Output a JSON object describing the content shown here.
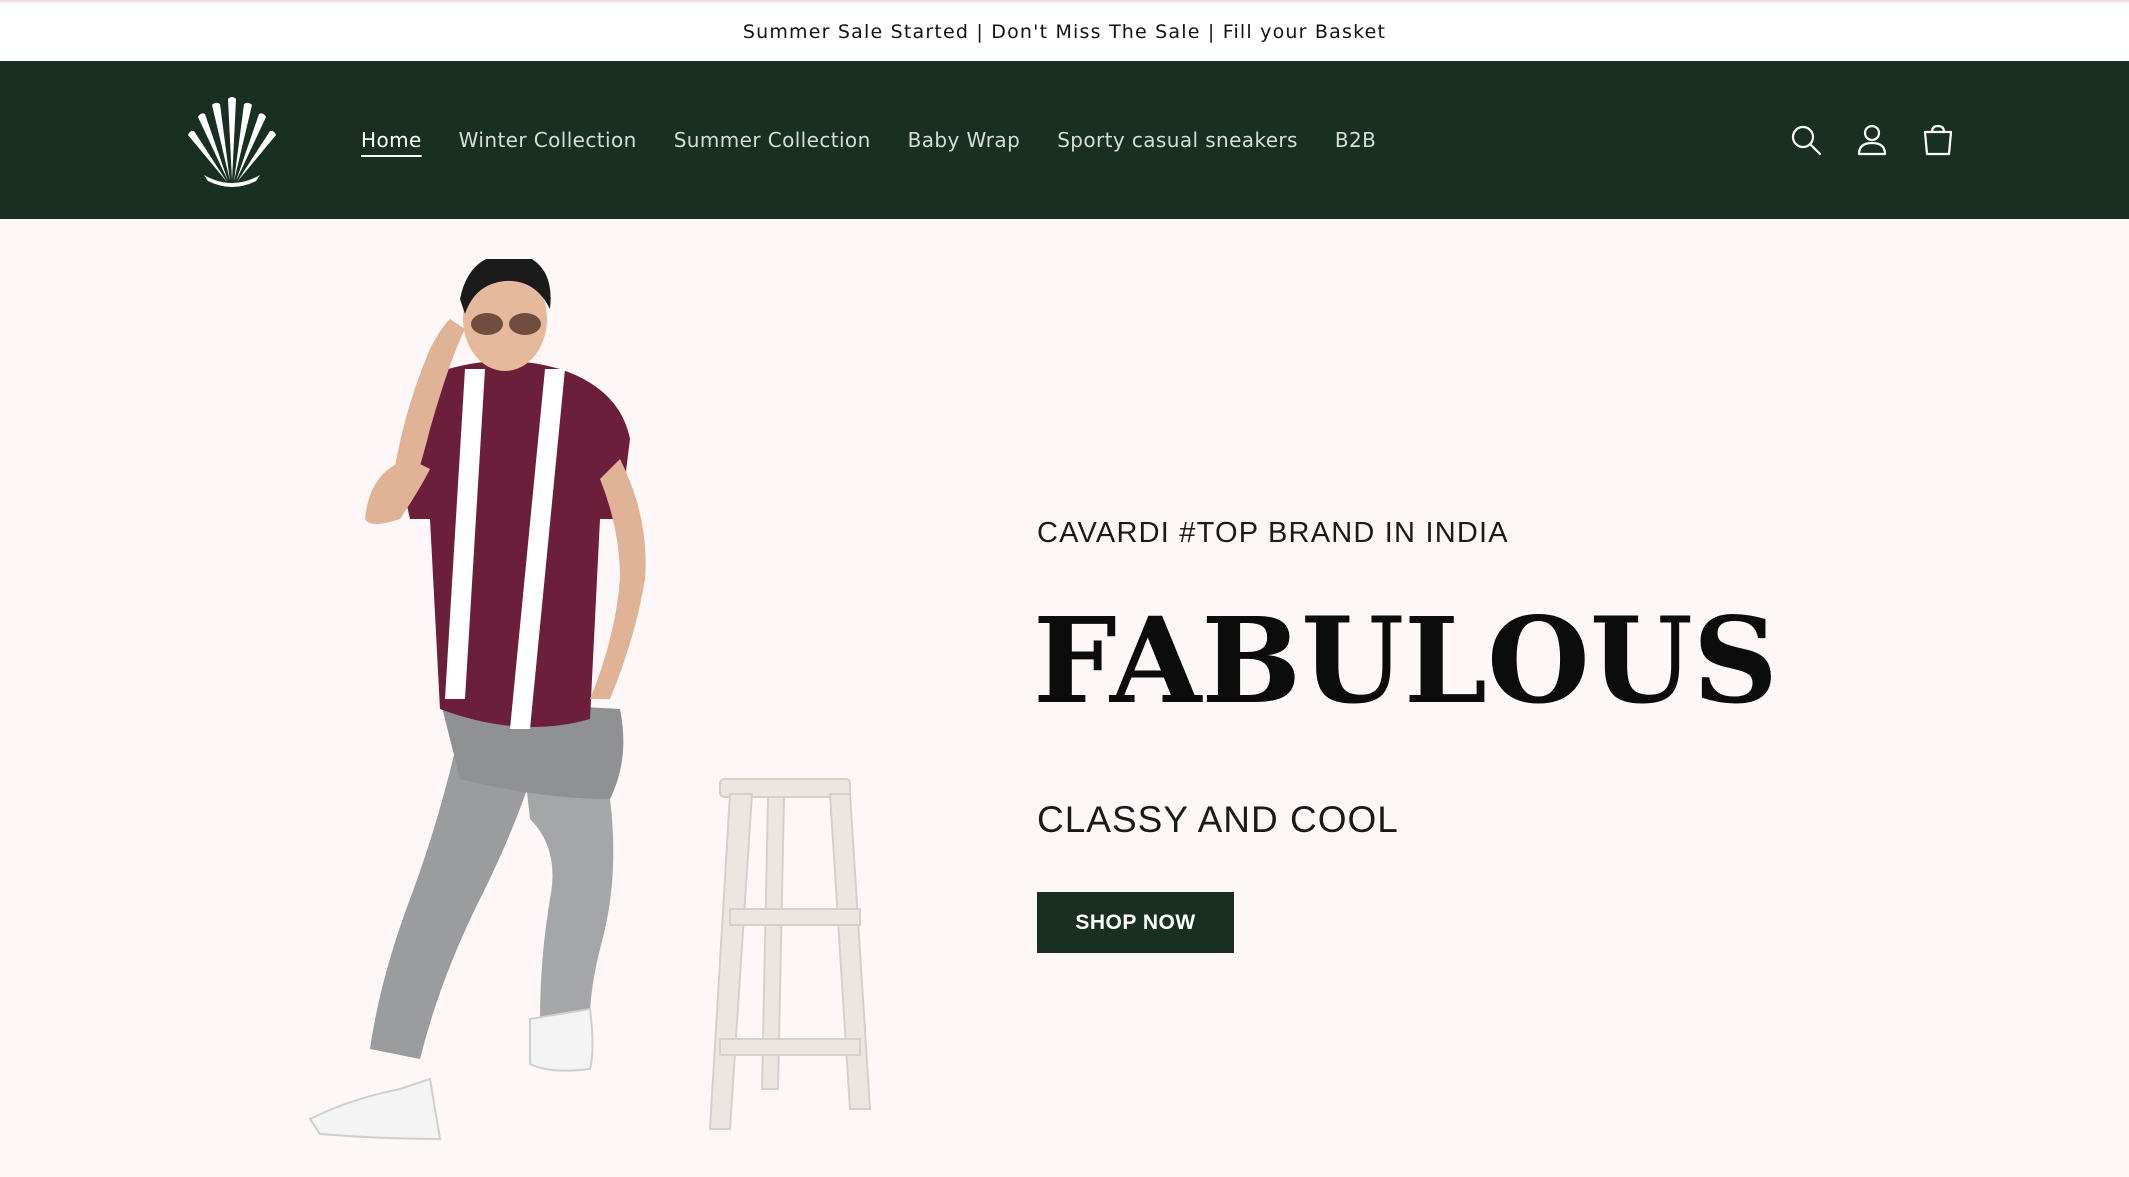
{
  "announcement": {
    "text": "Summer Sale Started | Don't Miss The Sale | Fill your Basket"
  },
  "header": {
    "logo_icon": "shell-fan-icon",
    "nav": [
      {
        "label": "Home",
        "active": true
      },
      {
        "label": "Winter Collection",
        "active": false
      },
      {
        "label": "Summer Collection",
        "active": false
      },
      {
        "label": "Baby Wrap",
        "active": false
      },
      {
        "label": "Sporty casual sneakers",
        "active": false
      },
      {
        "label": "B2B",
        "active": false
      }
    ],
    "icons": [
      "search-icon",
      "account-icon",
      "cart-icon"
    ]
  },
  "hero": {
    "tagline": "CAVARDI #TOP BRAND IN INDIA",
    "headline": "FABULOUS",
    "subline": "CLASSY AND COOL",
    "button_label": "SHOP NOW"
  },
  "colors": {
    "header_bg": "#182f22",
    "hero_bg": "#fdf8f7",
    "button_bg": "#182f22",
    "shirt": "#6b1f3a"
  }
}
